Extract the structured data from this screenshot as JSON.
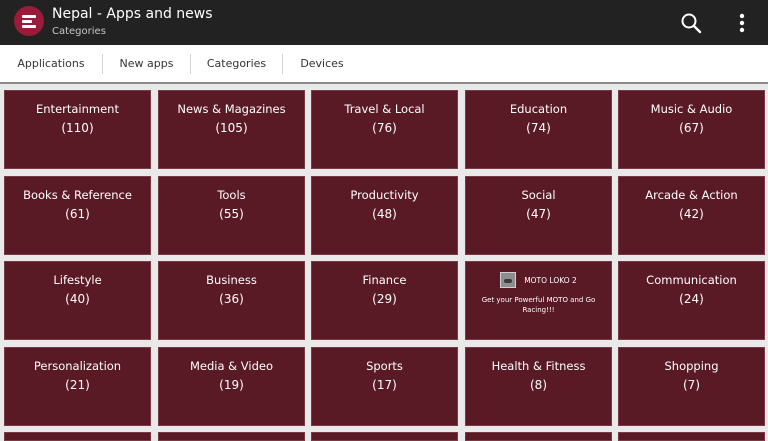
{
  "app": {
    "title": "Nepal - Apps and news",
    "subtitle": "Categories",
    "logo_icon": "app-logo-icon",
    "accent_color": "#9b1b3a"
  },
  "toolbar": {
    "search_icon": "search-icon",
    "menu_icon": "overflow-menu-icon"
  },
  "tabs": [
    {
      "label": "Applications"
    },
    {
      "label": "New apps"
    },
    {
      "label": "Categories"
    },
    {
      "label": "Devices"
    }
  ],
  "categories": [
    {
      "name": "Entertainment",
      "count": "(110)"
    },
    {
      "name": "News & Magazines",
      "count": "(105)"
    },
    {
      "name": "Travel & Local",
      "count": "(76)"
    },
    {
      "name": "Education",
      "count": "(74)"
    },
    {
      "name": "Music & Audio",
      "count": "(67)"
    },
    {
      "name": "Books & Reference",
      "count": "(61)"
    },
    {
      "name": "Tools",
      "count": "(55)"
    },
    {
      "name": "Productivity",
      "count": "(48)"
    },
    {
      "name": "Social",
      "count": "(47)"
    },
    {
      "name": "Arcade & Action",
      "count": "(42)"
    },
    {
      "name": "Lifestyle",
      "count": "(40)"
    },
    {
      "name": "Business",
      "count": "(36)"
    },
    {
      "name": "Finance",
      "count": "(29)"
    },
    {
      "name": "Communication",
      "count": "(24)"
    },
    {
      "name": "Personalization",
      "count": "(21)"
    },
    {
      "name": "Media & Video",
      "count": "(19)"
    },
    {
      "name": "Sports",
      "count": "(17)"
    },
    {
      "name": "Health & Fitness",
      "count": "(8)"
    },
    {
      "name": "Shopping",
      "count": "(7)"
    }
  ],
  "ad": {
    "title": "MOTO LOKO 2",
    "text": "Get your Powerful MOTO and Go Racing!!!"
  },
  "tile_color": "#5a1a25"
}
